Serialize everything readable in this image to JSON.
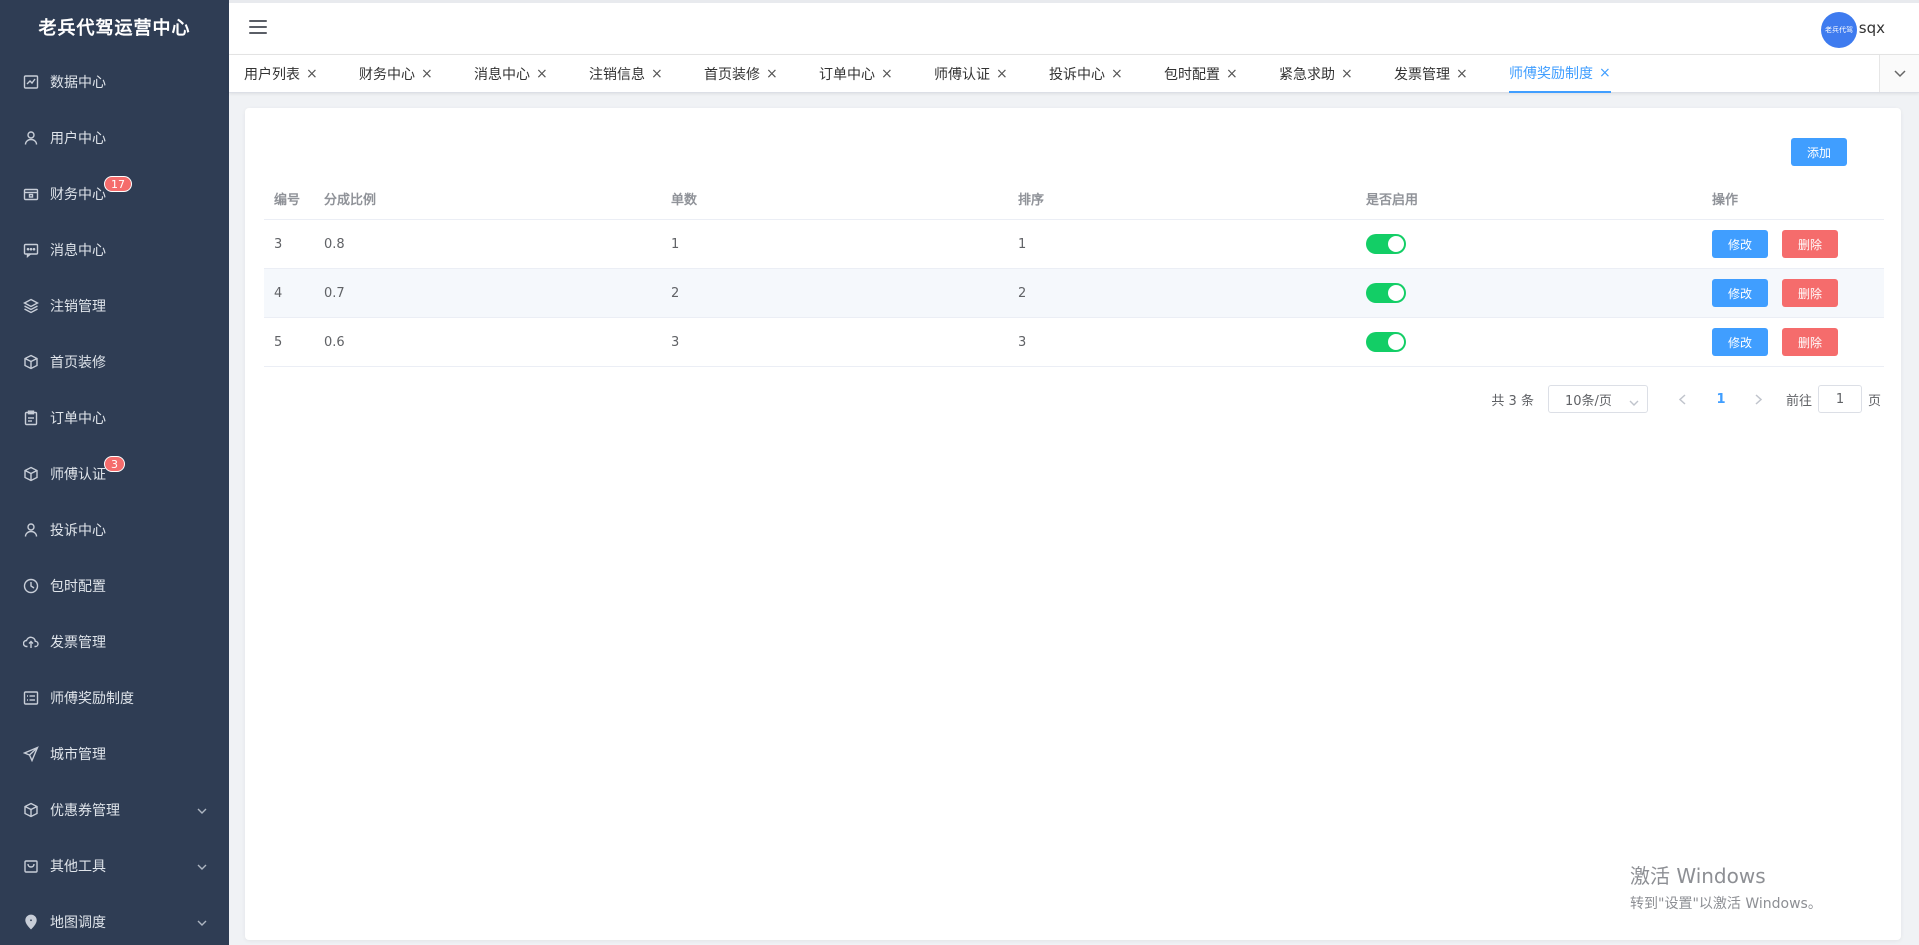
{
  "app": {
    "title": "老兵代驾运营中心"
  },
  "sidebar": {
    "items": [
      {
        "label": "数据中心",
        "icon": "chart-icon"
      },
      {
        "label": "用户中心",
        "icon": "user-icon"
      },
      {
        "label": "财务中心",
        "icon": "wallet-icon",
        "badge": "17"
      },
      {
        "label": "消息中心",
        "icon": "message-icon"
      },
      {
        "label": "注销管理",
        "icon": "layers-icon"
      },
      {
        "label": "首页装修",
        "icon": "box-icon"
      },
      {
        "label": "订单中心",
        "icon": "clipboard-icon"
      },
      {
        "label": "师傅认证",
        "icon": "box-icon",
        "badge": "3"
      },
      {
        "label": "投诉中心",
        "icon": "user-icon"
      },
      {
        "label": "包时配置",
        "icon": "clock-icon"
      },
      {
        "label": "发票管理",
        "icon": "cloud-upload-icon"
      },
      {
        "label": "师傅奖励制度",
        "icon": "list-icon"
      },
      {
        "label": "城市管理",
        "icon": "send-icon"
      },
      {
        "label": "优惠券管理",
        "icon": "box-icon",
        "submenu": true
      },
      {
        "label": "其他工具",
        "icon": "bag-icon",
        "submenu": true
      },
      {
        "label": "地图调度",
        "icon": "location-icon",
        "submenu": true
      }
    ]
  },
  "header": {
    "user": {
      "name": "sqx",
      "avatar_text": "老兵代驾"
    }
  },
  "tabs": [
    {
      "label": "用户列表"
    },
    {
      "label": "财务中心"
    },
    {
      "label": "消息中心"
    },
    {
      "label": "注销信息"
    },
    {
      "label": "首页装修"
    },
    {
      "label": "订单中心"
    },
    {
      "label": "师傅认证"
    },
    {
      "label": "投诉中心"
    },
    {
      "label": "包时配置"
    },
    {
      "label": "紧急求助"
    },
    {
      "label": "发票管理"
    },
    {
      "label": "师傅奖励制度",
      "active": true
    }
  ],
  "main": {
    "add_label": "添加",
    "table": {
      "columns": [
        "编号",
        "分成比例",
        "单数",
        "排序",
        "是否启用",
        "操作"
      ],
      "rows": [
        {
          "id": "3",
          "ratio": "0.8",
          "count": "1",
          "sort": "1",
          "enabled": true
        },
        {
          "id": "4",
          "ratio": "0.7",
          "count": "2",
          "sort": "2",
          "enabled": true
        },
        {
          "id": "5",
          "ratio": "0.6",
          "count": "3",
          "sort": "3",
          "enabled": true
        }
      ],
      "edit_label": "修改",
      "delete_label": "删除"
    },
    "pagination": {
      "total_text": "共 3 条",
      "page_size": "10条/页",
      "current_page": "1",
      "goto_prefix": "前往",
      "goto_value": "1",
      "goto_suffix": "页"
    }
  },
  "watermark": {
    "line1": "激活 Windows",
    "line2": "转到\"设置\"以激活 Windows。"
  },
  "colors": {
    "sidebar_bg": "#2f3d54",
    "primary": "#409eff",
    "danger": "#f56c6c",
    "switch_on": "#13ce66",
    "badge": "#f56c6c"
  }
}
